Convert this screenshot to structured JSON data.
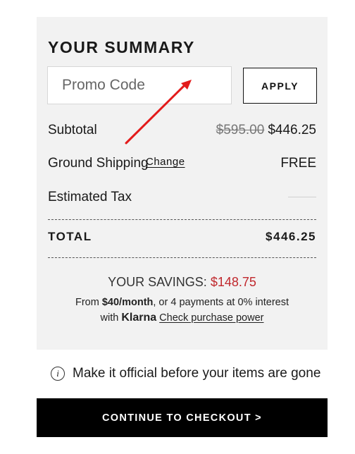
{
  "summary": {
    "title": "YOUR SUMMARY",
    "promo": {
      "placeholder": "Promo Code",
      "apply_label": "APPLY"
    },
    "rows": {
      "subtotal": {
        "label": "Subtotal",
        "original_price": "$595.00",
        "price": "$446.25"
      },
      "shipping": {
        "label": "Ground Shipping",
        "change_label": "Change",
        "value": "FREE"
      },
      "tax": {
        "label": "Estimated Tax"
      }
    },
    "total": {
      "label": "TOTAL",
      "value": "$446.25"
    },
    "savings": {
      "label": "YOUR SAVINGS:",
      "amount": "$148.75"
    },
    "klarna": {
      "prefix": "From",
      "amount": "$40/month",
      "suffix": ", or 4 payments at 0% interest",
      "with": "with",
      "brand": "Klarna",
      "link": "Check purchase power"
    }
  },
  "notice": {
    "text": "Make it official before your items are gone",
    "icon": "info-icon"
  },
  "checkout": {
    "label": "CONTINUE TO CHECKOUT >"
  },
  "colors": {
    "panel_bg": "#f2f2f2",
    "savings_red": "#c0282d",
    "arrow_red": "#e31b1b",
    "button_black": "#000000"
  }
}
